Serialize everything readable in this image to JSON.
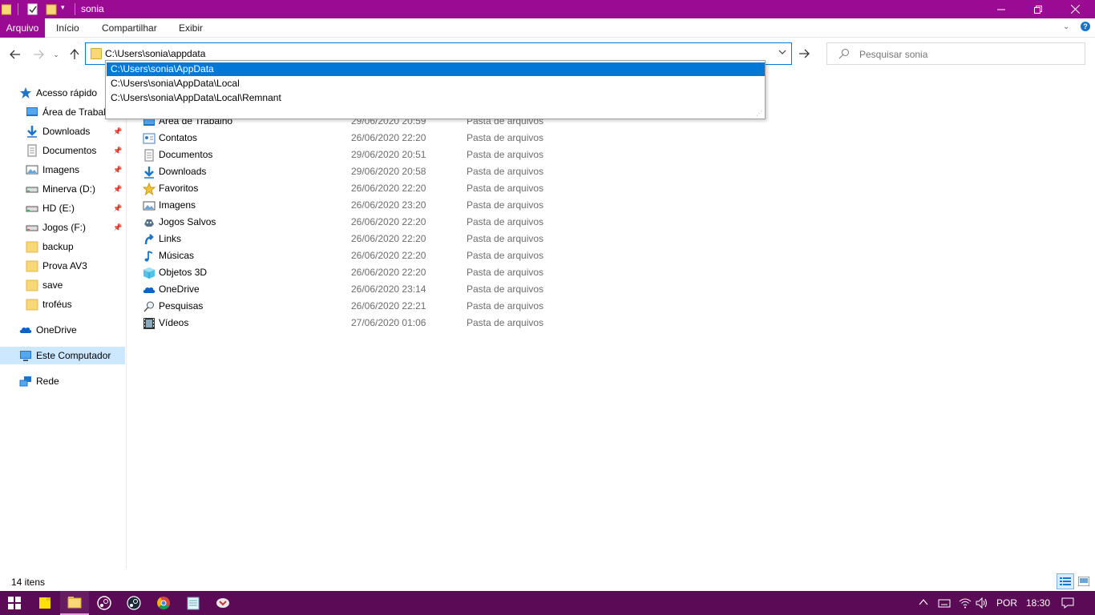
{
  "window": {
    "title": "sonia"
  },
  "ribbon": {
    "tabs": [
      "Arquivo",
      "Início",
      "Compartilhar",
      "Exibir"
    ]
  },
  "address": {
    "value": "C:\\Users\\sonia\\appdata"
  },
  "search": {
    "placeholder": "Pesquisar sonia"
  },
  "autocomplete": [
    "C:\\Users\\sonia\\AppData",
    "C:\\Users\\sonia\\AppData\\Local",
    "C:\\Users\\sonia\\AppData\\Local\\Remnant"
  ],
  "sidebar": {
    "items": [
      {
        "label": "Acesso rápido",
        "icon": "star-icon",
        "pinned": false
      },
      {
        "label": "Área de Trabalho",
        "icon": "desktop-icon",
        "pinned": true
      },
      {
        "label": "Downloads",
        "icon": "download-icon",
        "pinned": true
      },
      {
        "label": "Documentos",
        "icon": "document-icon",
        "pinned": true
      },
      {
        "label": "Imagens",
        "icon": "image-icon",
        "pinned": true
      },
      {
        "label": "Minerva (D:)",
        "icon": "drive-icon",
        "pinned": true
      },
      {
        "label": "HD (E:)",
        "icon": "drive-icon",
        "pinned": true
      },
      {
        "label": "Jogos (F:)",
        "icon": "drive-icon",
        "pinned": true
      },
      {
        "label": "backup",
        "icon": "folder-icon",
        "pinned": false
      },
      {
        "label": "Prova AV3",
        "icon": "folder-icon",
        "pinned": false
      },
      {
        "label": "save",
        "icon": "folder-icon",
        "pinned": false
      },
      {
        "label": "troféus",
        "icon": "folder-icon",
        "pinned": false
      },
      {
        "label": "OneDrive",
        "icon": "cloud-icon",
        "pinned": false
      },
      {
        "label": "Este Computador",
        "icon": "computer-icon",
        "pinned": false
      },
      {
        "label": "Rede",
        "icon": "network-icon",
        "pinned": false
      }
    ]
  },
  "files": [
    {
      "name": "Área de Trabalho",
      "date": "29/06/2020 20:59",
      "type": "Pasta de arquivos"
    },
    {
      "name": "Contatos",
      "date": "26/06/2020 22:20",
      "type": "Pasta de arquivos"
    },
    {
      "name": "Documentos",
      "date": "29/06/2020 20:51",
      "type": "Pasta de arquivos"
    },
    {
      "name": "Downloads",
      "date": "29/06/2020 20:58",
      "type": "Pasta de arquivos"
    },
    {
      "name": "Favoritos",
      "date": "26/06/2020 22:20",
      "type": "Pasta de arquivos"
    },
    {
      "name": "Imagens",
      "date": "26/06/2020 23:20",
      "type": "Pasta de arquivos"
    },
    {
      "name": "Jogos Salvos",
      "date": "26/06/2020 22:20",
      "type": "Pasta de arquivos"
    },
    {
      "name": "Links",
      "date": "26/06/2020 22:20",
      "type": "Pasta de arquivos"
    },
    {
      "name": "Músicas",
      "date": "26/06/2020 22:20",
      "type": "Pasta de arquivos"
    },
    {
      "name": "Objetos 3D",
      "date": "26/06/2020 22:20",
      "type": "Pasta de arquivos"
    },
    {
      "name": "OneDrive",
      "date": "26/06/2020 23:14",
      "type": "Pasta de arquivos"
    },
    {
      "name": "Pesquisas",
      "date": "26/06/2020 22:21",
      "type": "Pasta de arquivos"
    },
    {
      "name": "Vídeos",
      "date": "27/06/2020 01:06",
      "type": "Pasta de arquivos"
    }
  ],
  "status": {
    "count": "14 itens"
  },
  "taskbar": {
    "lang": "POR",
    "time": "18:30"
  },
  "colors": {
    "accent": "#9b0a92",
    "taskbar": "#5b0a55",
    "selection": "#0078d7"
  }
}
